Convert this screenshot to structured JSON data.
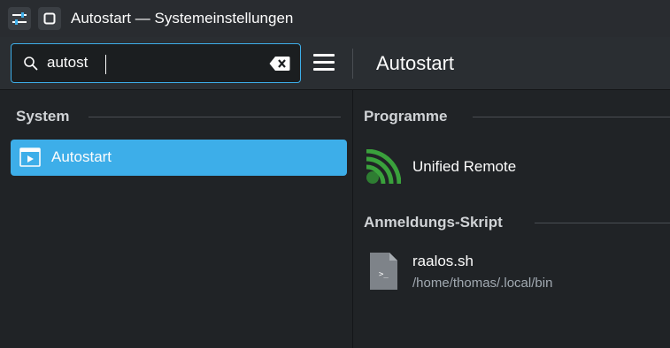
{
  "window": {
    "title": "Autostart — Systemeinstellungen"
  },
  "search": {
    "value": "autost",
    "placeholder": ""
  },
  "page": {
    "title": "Autostart"
  },
  "sidebar": {
    "section": "System",
    "items": [
      {
        "label": "Autostart",
        "icon": "autostart-icon",
        "selected": true
      }
    ]
  },
  "main": {
    "sections": [
      {
        "title": "Programme",
        "entries": [
          {
            "name": "Unified Remote",
            "icon": "unified-remote-icon"
          }
        ]
      },
      {
        "title": "Anmeldungs-Skript",
        "entries": [
          {
            "name": "raalos.sh",
            "path": "/home/thomas/.local/bin",
            "icon": "script-file-icon"
          }
        ]
      }
    ]
  },
  "colors": {
    "accent": "#3daee9",
    "background": "#202326",
    "header_background": "#2a2e32",
    "unified_remote_green": "#3aa13c"
  }
}
